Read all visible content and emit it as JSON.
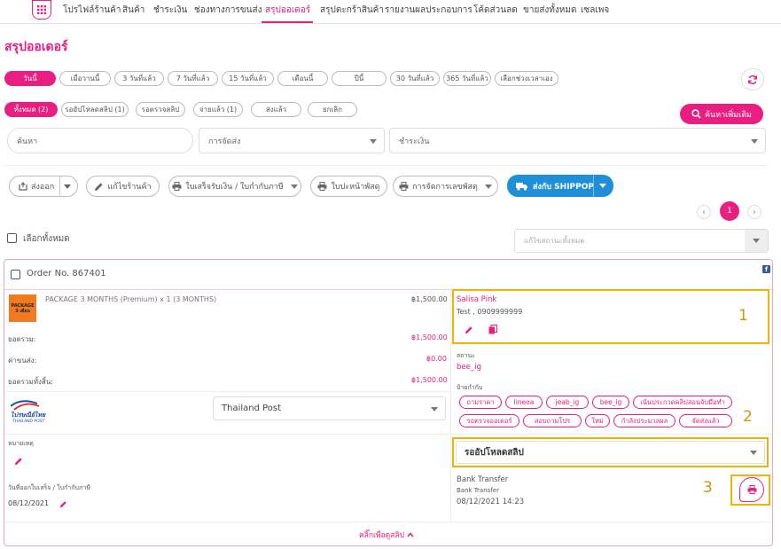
{
  "nav": {
    "items": [
      "โปรไฟล์ร้านค้า",
      "สินค้า",
      "ชำระเงิน",
      "ช่องทางการขนส่ง",
      "สรุปออเดอร์",
      "สรุปตะกร้าสินค้า",
      "รายงานผลประกอบการ",
      "โค้ดส่วนลด",
      "ขายส่งทั้งหมด",
      "เซลเพจ"
    ]
  },
  "page_title": "สรุปออเดอร์",
  "date_filters": [
    "วันนี้",
    "เมื่อวานนี้",
    "3 วันที่แล้ว",
    "7 วันที่แล้ว",
    "15 วันที่แล้ว",
    "เดือนนี้",
    "ปีนี้",
    "30 วันที่แล้ว",
    "365 วันที่แล้ว",
    "เลือกช่วงเวลาเอง"
  ],
  "status_filters": [
    "ทั้งหมด (2)",
    "รออัปโหลดสลิป (1)",
    "รอตรวจสลิป",
    "จ่ายแล้ว (1)",
    "ส่งแล้ว",
    "ยกเลิก"
  ],
  "search_more_label": "ค้นหาเพิ่มเติม",
  "search": {
    "placeholder": "ค้นหา",
    "shipping": "การจัดส่ง",
    "payment": "ชำระเงิน"
  },
  "toolbar": {
    "export": "ส่งออก",
    "edit_shop": "แก้ไขร้านค้า",
    "receipt": "ใบเสร็จรับเงิน / ใบกำกับภาษี",
    "cover": "ใบปะหน้าพัสดุ",
    "parcel_number": "การจัดการเลขพัสดุ",
    "shippop": "ส่งกับ SHIPPOP"
  },
  "pagination": {
    "current": "1"
  },
  "select_all": "เลือกทั้งหมด",
  "bulk_status_placeholder": "แก้ไขสถานะทั้งหมด",
  "order": {
    "number": "Order No. 867401",
    "product_thumb": "PACKAGE 3 เดือน",
    "product_name": "PACKAGE 3 MONTHS (Premium) x 1 (3 MONTHS)",
    "product_price": "฿1,500.00",
    "subtotal_label": "ยอดรวม:",
    "subtotal": "฿1,500.00",
    "shipping_label": "ค่าขนส่ง:",
    "shipping": "฿0.00",
    "total_label": "ยอดรวมทั้งสิ้น:",
    "total": "฿1,500.00",
    "carrier_logo": "ไปรษณีย์ไทย",
    "carrier_logo_sub": "THAILAND POST",
    "carrier": "Thailand Post",
    "note_label": "หมายเหตุ",
    "receipt_date_label": "วันที่ออกใบเสร็จ / ใบกำกับภาษี",
    "receipt_date": "08/12/2021",
    "customer_name": "Salisa Pink",
    "customer_contact": "Test , 0909999999",
    "channel_label": "สถานะ",
    "channel": "bee_ig",
    "tags_label": "ป้ายกำกับ",
    "tags": [
      "ถามราคา",
      "lineoa",
      "jeab_ig",
      "bee_ig",
      "เน้นประกวดคลิปสอนจับมือทำ",
      "รอตรวจออเดอร์",
      "สอบถามโปร",
      "ใหม่",
      "กำลังประมวลผล",
      "จัดส่งแล้ว"
    ],
    "status": "รออัปโหลดสลิป",
    "payment_method": "Bank Transfer",
    "payment_method_sub": "Bank Transfer",
    "payment_time": "08/12/2021 14:23",
    "view_slip": "คลิ๊กเพื่อดูสลิป"
  },
  "annotations": [
    "1",
    "2",
    "3"
  ],
  "colors": {
    "accent": "#e91e80",
    "highlight": "#f0b400",
    "shippop": "#1f8fd8"
  }
}
